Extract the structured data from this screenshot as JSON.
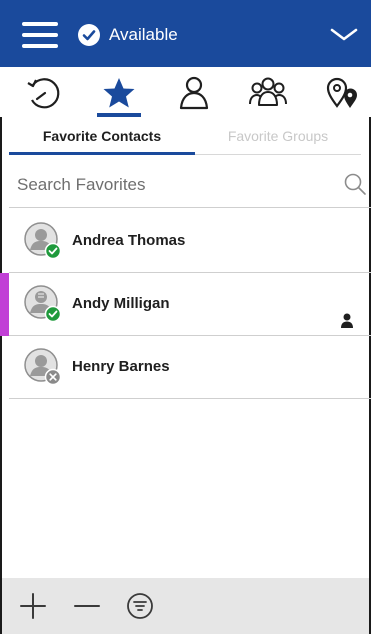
{
  "header": {
    "status_label": "Available",
    "menu_icon": "hamburger-menu-icon",
    "status_icon": "check-circle-icon",
    "chevron_icon": "chevron-down-icon"
  },
  "icon_tabs": [
    {
      "name": "history",
      "icon": "clock-history-icon"
    },
    {
      "name": "favorites",
      "icon": "star-icon",
      "active": true
    },
    {
      "name": "contacts",
      "icon": "person-icon"
    },
    {
      "name": "groups",
      "icon": "group-icon"
    },
    {
      "name": "locations",
      "icon": "map-pins-icon"
    }
  ],
  "sub_tabs": {
    "favorite_contacts": "Favorite Contacts",
    "favorite_groups": "Favorite Groups"
  },
  "search": {
    "placeholder": "Search Favorites",
    "value": ""
  },
  "contacts": [
    {
      "name": "Andrea Thomas",
      "status": "available",
      "selected": false
    },
    {
      "name": "Andy Milligan",
      "status": "available",
      "selected": true
    },
    {
      "name": "Henry Barnes",
      "status": "offline",
      "selected": false
    }
  ],
  "bottom_bar": [
    {
      "icon": "plus-icon"
    },
    {
      "icon": "minus-icon"
    },
    {
      "icon": "filter-icon"
    }
  ],
  "colors": {
    "header_bg": "#1a4a9c",
    "accent": "#1a4a9c",
    "selected_marker": "#c13fd6",
    "available_badge": "#1f9a3c",
    "offline_badge": "#8a8a8a"
  }
}
